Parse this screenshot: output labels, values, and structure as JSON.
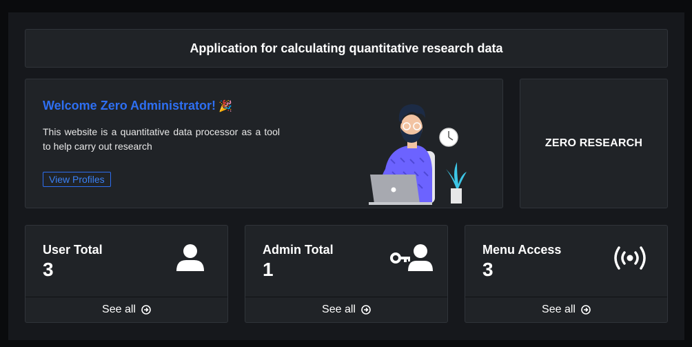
{
  "header": {
    "title": "Application for calculating quantitative research data"
  },
  "welcome": {
    "heading": "Welcome Zero Administrator!",
    "emoji": "🎉",
    "description": "This website is a quantitative data processor as a tool to help carry out research",
    "button_label": "View Profiles"
  },
  "brand": {
    "name": "ZERO RESEARCH"
  },
  "stats": [
    {
      "label": "User Total",
      "value": "3",
      "link": "See all",
      "icon": "user-icon"
    },
    {
      "label": "Admin Total",
      "value": "1",
      "link": "See all",
      "icon": "user-key-icon"
    },
    {
      "label": "Menu Access",
      "value": "3",
      "link": "See all",
      "icon": "broadcast-icon"
    }
  ],
  "colors": {
    "accent": "#2e6ff2",
    "card": "#202327",
    "background": "#16181c"
  }
}
